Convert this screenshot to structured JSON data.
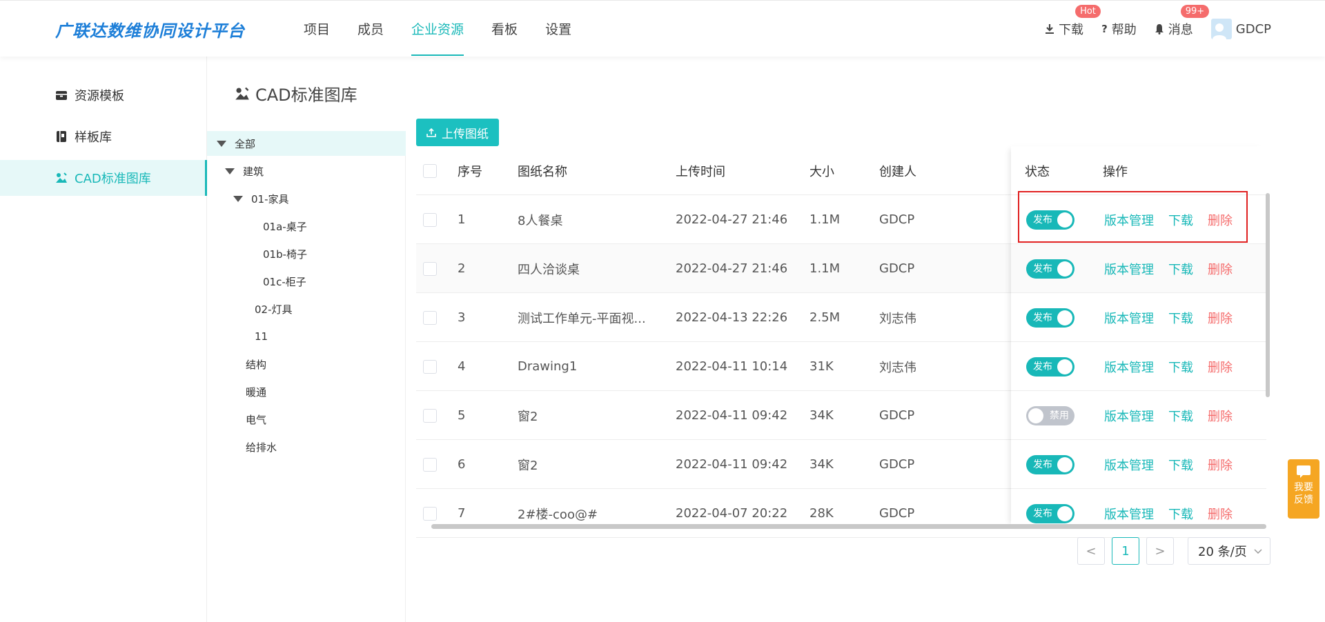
{
  "header": {
    "logo": "广联达数维协同设计平台",
    "nav": [
      "项目",
      "成员",
      "企业资源",
      "看板",
      "设置"
    ],
    "download": "下载",
    "download_badge": "Hot",
    "help": "帮助",
    "messages": "消息",
    "messages_badge": "99+",
    "user": "GDCP"
  },
  "sidebar": {
    "items": [
      {
        "label": "资源模板",
        "icon": "box-icon"
      },
      {
        "label": "样板库",
        "icon": "book-icon"
      },
      {
        "label": "CAD标准图库",
        "icon": "image-icon"
      }
    ]
  },
  "page_title": "CAD标准图库",
  "tree": {
    "nodes": [
      "全部",
      "建筑",
      "01-家具",
      "01a-桌子",
      "01b-椅子",
      "01c-柜子",
      "02-灯具",
      "11",
      "结构",
      "暖通",
      "电气",
      "给排水"
    ]
  },
  "upload_button": "上传图纸",
  "table": {
    "headers": {
      "index": "序号",
      "name": "图纸名称",
      "time": "上传时间",
      "size": "大小",
      "creator": "创建人",
      "status": "状态",
      "actions": "操作"
    },
    "rows": [
      {
        "index": "1",
        "name": "8人餐桌",
        "time": "2022-04-27 21:46",
        "size": "1.1M",
        "creator": "GDCP",
        "status": "发布"
      },
      {
        "index": "2",
        "name": "四人洽谈桌",
        "time": "2022-04-27 21:46",
        "size": "1.1M",
        "creator": "GDCP",
        "status": "发布"
      },
      {
        "index": "3",
        "name": "测试工作单元-平面视...",
        "time": "2022-04-13 22:26",
        "size": "2.5M",
        "creator": "刘志伟",
        "status": "发布"
      },
      {
        "index": "4",
        "name": "Drawing1",
        "time": "2022-04-11 10:14",
        "size": "31K",
        "creator": "刘志伟",
        "status": "发布"
      },
      {
        "index": "5",
        "name": "窗2",
        "time": "2022-04-11 09:42",
        "size": "34K",
        "creator": "GDCP",
        "status": "禁用"
      },
      {
        "index": "6",
        "name": "窗2",
        "time": "2022-04-11 09:42",
        "size": "34K",
        "creator": "GDCP",
        "status": "发布"
      },
      {
        "index": "7",
        "name": "2#楼-coo@#",
        "time": "2022-04-07 20:22",
        "size": "28K",
        "creator": "GDCP",
        "status": "发布"
      }
    ],
    "action_version": "版本管理",
    "action_download": "下载",
    "action_delete": "删除"
  },
  "pagination": {
    "prev": "<",
    "current": "1",
    "next": ">",
    "page_size": "20 条/页"
  },
  "feedback": "我要反馈",
  "colors": {
    "accent": "#18b8b8",
    "danger": "#f56c6c",
    "logo": "#1e7fd8",
    "feedback": "#f5a623"
  }
}
